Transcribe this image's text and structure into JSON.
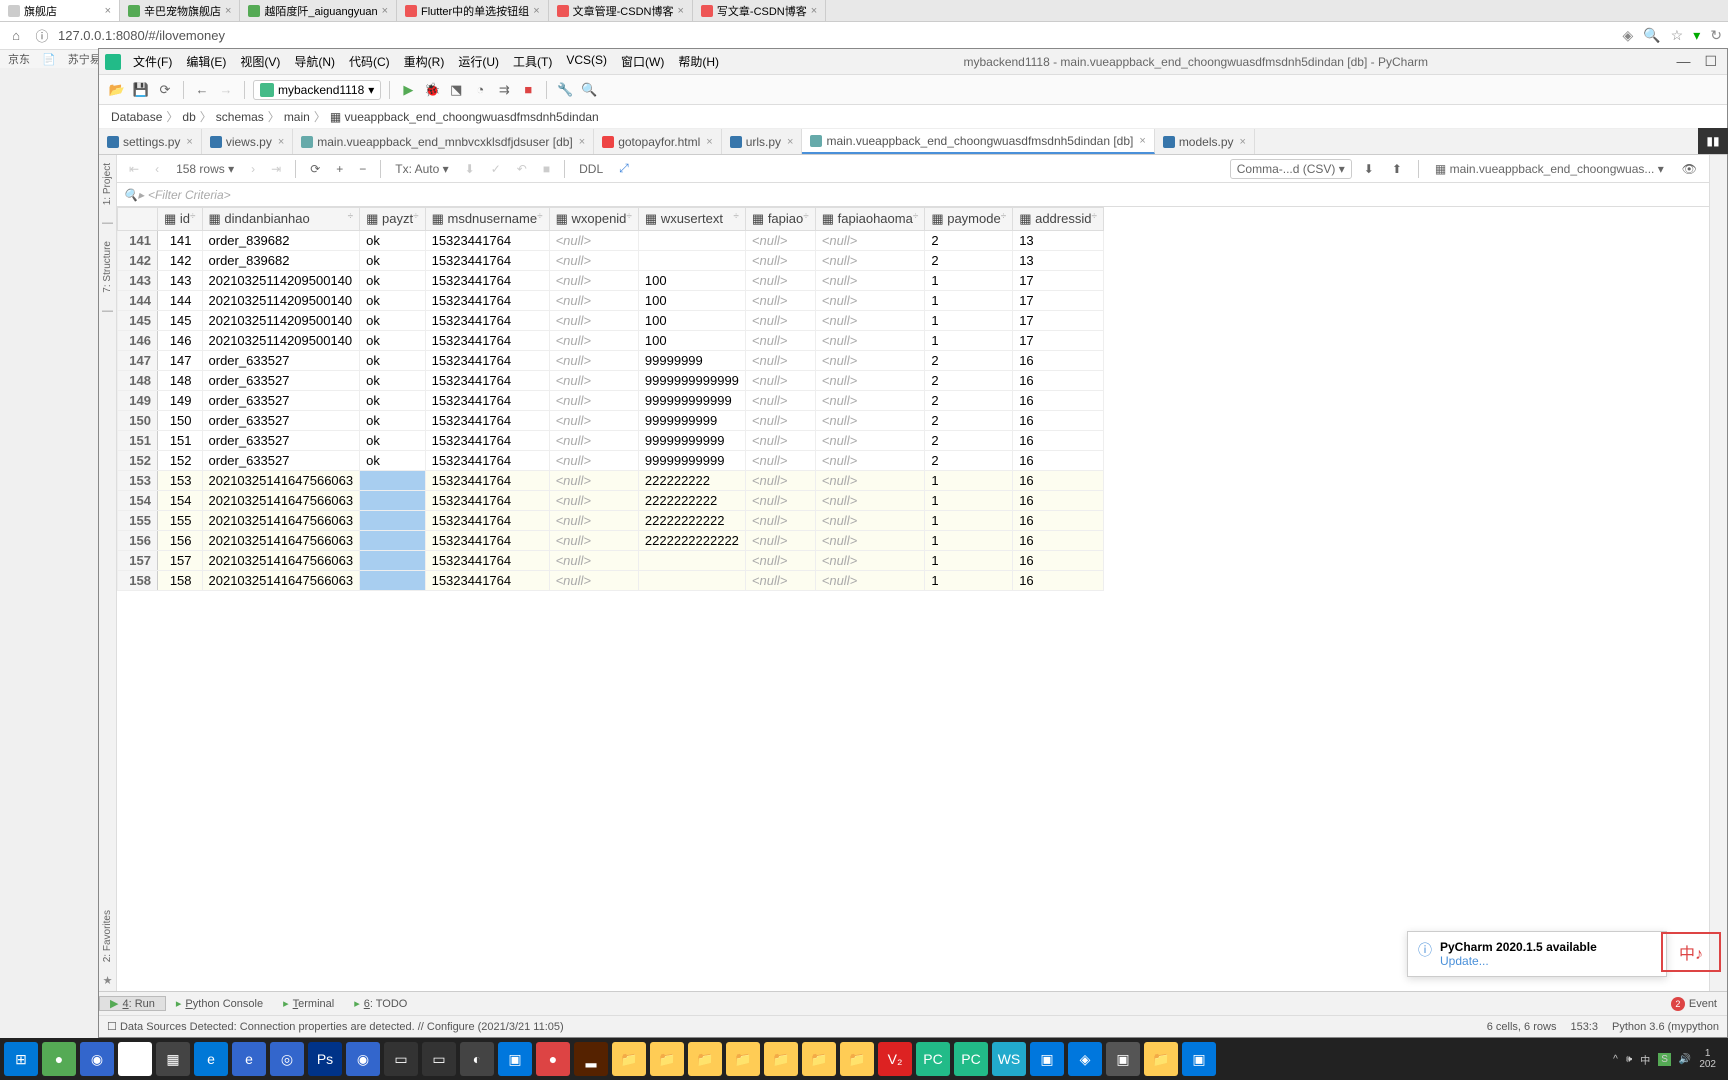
{
  "browser": {
    "tabs": [
      {
        "title": "旗舰店",
        "active": true
      },
      {
        "title": "辛巴宠物旗舰店"
      },
      {
        "title": "越陌度阡_aiguangyuan"
      },
      {
        "title": "Flutter中的单选按钮组"
      },
      {
        "title": "文章管理-CSDN博客"
      },
      {
        "title": "写文章-CSDN博客"
      }
    ],
    "url": "127.0.0.1:8080/#/ilovemoney",
    "bookmarks": [
      "京东",
      "📄",
      "苏宁易购"
    ]
  },
  "pycharm": {
    "menus": [
      "文件(F)",
      "编辑(E)",
      "视图(V)",
      "导航(N)",
      "代码(C)",
      "重构(R)",
      "运行(U)",
      "工具(T)",
      "VCS(S)",
      "窗口(W)",
      "帮助(H)"
    ],
    "title": "mybackend1118 - main.vueappback_end_choongwuasdfmsdnh5dindan [db] - PyCharm",
    "config": "mybackend1118",
    "breadcrumb": [
      "Database",
      "db",
      "schemas",
      "main",
      "vueappback_end_choongwuasdfmsdnh5dindan"
    ],
    "editor_tabs": [
      {
        "name": "settings.py",
        "type": "py"
      },
      {
        "name": "views.py",
        "type": "py"
      },
      {
        "name": "main.vueappback_end_mnbvcxklsdfjdsuser [db]",
        "type": "db"
      },
      {
        "name": "gotopayfor.html",
        "type": "html"
      },
      {
        "name": "urls.py",
        "type": "py"
      },
      {
        "name": "main.vueappback_end_choongwuasdfmsdnh5dindan [db]",
        "type": "db",
        "active": true
      },
      {
        "name": "models.py",
        "type": "py"
      }
    ],
    "rows_label": "158 rows",
    "tx_label": "Tx: Auto",
    "ddl_label": "DDL",
    "csv_label": "Comma-...d (CSV)",
    "path_label": "main.vueappback_end_choongwuas...",
    "filter_placeholder": "<Filter Criteria>",
    "columns": [
      "id",
      "dindanbianhao",
      "payzt",
      "msdnusername",
      "wxopenid",
      "wxusertext",
      "fapiao",
      "fapiaohaoma",
      "paymode",
      "addressid"
    ],
    "data": [
      {
        "n": 141,
        "id": 141,
        "db": "order_839682",
        "pz": "ok",
        "ms": "15323441764",
        "wo": "<null>",
        "wt": "",
        "fp": "<null>",
        "fh": "<null>",
        "pm": "2",
        "ad": "13"
      },
      {
        "n": 142,
        "id": 142,
        "db": "order_839682",
        "pz": "ok",
        "ms": "15323441764",
        "wo": "<null>",
        "wt": "",
        "fp": "<null>",
        "fh": "<null>",
        "pm": "2",
        "ad": "13"
      },
      {
        "n": 143,
        "id": 143,
        "db": "20210325114209500140",
        "pz": "ok",
        "ms": "15323441764",
        "wo": "<null>",
        "wt": "100",
        "fp": "<null>",
        "fh": "<null>",
        "pm": "1",
        "ad": "17"
      },
      {
        "n": 144,
        "id": 144,
        "db": "20210325114209500140",
        "pz": "ok",
        "ms": "15323441764",
        "wo": "<null>",
        "wt": "100",
        "fp": "<null>",
        "fh": "<null>",
        "pm": "1",
        "ad": "17"
      },
      {
        "n": 145,
        "id": 145,
        "db": "20210325114209500140",
        "pz": "ok",
        "ms": "15323441764",
        "wo": "<null>",
        "wt": "100",
        "fp": "<null>",
        "fh": "<null>",
        "pm": "1",
        "ad": "17"
      },
      {
        "n": 146,
        "id": 146,
        "db": "20210325114209500140",
        "pz": "ok",
        "ms": "15323441764",
        "wo": "<null>",
        "wt": "100",
        "fp": "<null>",
        "fh": "<null>",
        "pm": "1",
        "ad": "17"
      },
      {
        "n": 147,
        "id": 147,
        "db": "order_633527",
        "pz": "ok",
        "ms": "15323441764",
        "wo": "<null>",
        "wt": "99999999",
        "fp": "<null>",
        "fh": "<null>",
        "pm": "2",
        "ad": "16"
      },
      {
        "n": 148,
        "id": 148,
        "db": "order_633527",
        "pz": "ok",
        "ms": "15323441764",
        "wo": "<null>",
        "wt": "9999999999999",
        "fp": "<null>",
        "fh": "<null>",
        "pm": "2",
        "ad": "16"
      },
      {
        "n": 149,
        "id": 149,
        "db": "order_633527",
        "pz": "ok",
        "ms": "15323441764",
        "wo": "<null>",
        "wt": "999999999999",
        "fp": "<null>",
        "fh": "<null>",
        "pm": "2",
        "ad": "16"
      },
      {
        "n": 150,
        "id": 150,
        "db": "order_633527",
        "pz": "ok",
        "ms": "15323441764",
        "wo": "<null>",
        "wt": "9999999999",
        "fp": "<null>",
        "fh": "<null>",
        "pm": "2",
        "ad": "16"
      },
      {
        "n": 151,
        "id": 151,
        "db": "order_633527",
        "pz": "ok",
        "ms": "15323441764",
        "wo": "<null>",
        "wt": "99999999999",
        "fp": "<null>",
        "fh": "<null>",
        "pm": "2",
        "ad": "16"
      },
      {
        "n": 152,
        "id": 152,
        "db": "order_633527",
        "pz": "ok",
        "ms": "15323441764",
        "wo": "<null>",
        "wt": "99999999999",
        "fp": "<null>",
        "fh": "<null>",
        "pm": "2",
        "ad": "16"
      },
      {
        "n": 153,
        "id": 153,
        "db": "20210325141647566063",
        "pz": "",
        "ms": "15323441764",
        "wo": "<null>",
        "wt": "222222222",
        "fp": "<null>",
        "fh": "<null>",
        "pm": "1",
        "ad": "16",
        "sel": true
      },
      {
        "n": 154,
        "id": 154,
        "db": "20210325141647566063",
        "pz": "",
        "ms": "15323441764",
        "wo": "<null>",
        "wt": "2222222222",
        "fp": "<null>",
        "fh": "<null>",
        "pm": "1",
        "ad": "16",
        "sel": true
      },
      {
        "n": 155,
        "id": 155,
        "db": "20210325141647566063",
        "pz": "",
        "ms": "15323441764",
        "wo": "<null>",
        "wt": "22222222222",
        "fp": "<null>",
        "fh": "<null>",
        "pm": "1",
        "ad": "16",
        "sel": true
      },
      {
        "n": 156,
        "id": 156,
        "db": "20210325141647566063",
        "pz": "",
        "ms": "15323441764",
        "wo": "<null>",
        "wt": "2222222222222",
        "fp": "<null>",
        "fh": "<null>",
        "pm": "1",
        "ad": "16",
        "sel": true
      },
      {
        "n": 157,
        "id": 157,
        "db": "20210325141647566063",
        "pz": "",
        "ms": "15323441764",
        "wo": "<null>",
        "wt": "",
        "fp": "<null>",
        "fh": "<null>",
        "pm": "1",
        "ad": "16",
        "sel": true
      },
      {
        "n": 158,
        "id": 158,
        "db": "20210325141647566063",
        "pz": "",
        "ms": "15323441764",
        "wo": "<null>",
        "wt": "",
        "fp": "<null>",
        "fh": "<null>",
        "pm": "1",
        "ad": "16",
        "sel": true
      }
    ],
    "left_tabs": [
      "1: Project",
      "7: Structure",
      "2: Favorites"
    ],
    "notification": {
      "title": "PyCharm 2020.1.5 available",
      "link": "Update..."
    },
    "bottom_tabs": [
      {
        "name": "4: Run",
        "active": true
      },
      {
        "name": "Python Console"
      },
      {
        "name": "Terminal"
      },
      {
        "name": "6: TODO"
      }
    ],
    "event_log": "Event",
    "status_left": "Data Sources Detected: Connection properties are detected. // Configure (2021/3/21 11:05)",
    "status_right": [
      "6 cells, 6 rows",
      "153:3",
      "Python 3.6 (mypython"
    ]
  },
  "taskbar": {
    "time": "1\n202"
  }
}
